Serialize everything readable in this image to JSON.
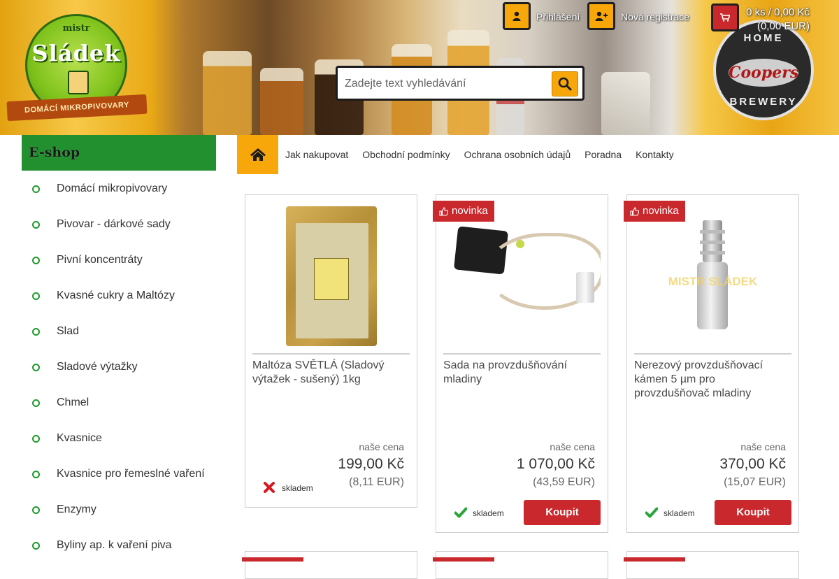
{
  "header": {
    "logo_left": {
      "top_text": "mistr",
      "main_text": "Sládek",
      "ribbon_text": "Domácí mikropivovary"
    },
    "logo_right": {
      "top_text": "HOME",
      "brand_text": "Coopers",
      "bottom_text": "BREWERY"
    },
    "login_label": "Přihlášení",
    "register_label": "Nová registrace",
    "cart_count_line": "0 ks / 0,00 Kč",
    "cart_eur_line": "(0,00 EUR)",
    "search_placeholder": "Zadejte text vyhledávání"
  },
  "sidebar": {
    "title": "E-shop",
    "items": [
      "Domácí mikropivovary",
      "Pivovar - dárkové sady",
      "Pivní koncentráty",
      "Kvasné cukry a Maltózy",
      "Slad",
      "Sladové výtažky",
      "Chmel",
      "Kvasnice",
      "Kvasnice pro řemeslné vaření",
      "Enzymy",
      "Byliny ap. k vaření piva"
    ]
  },
  "nav": {
    "items": [
      "Jak nakupovat",
      "Obchodní podmínky",
      "Ochrana osobních údajů",
      "Poradna",
      "Kontakty"
    ]
  },
  "products": [
    {
      "name": "Maltóza SVĚTLÁ (Sladový výtažek - sušený) 1kg",
      "price_label": "naše cena",
      "price": "199,00 Kč",
      "price_eur": "(8,11 EUR)",
      "stock": "skladem",
      "in_stock": false,
      "badge": "",
      "buy_label": ""
    },
    {
      "name": "Sada na provzdušňování mladiny",
      "price_label": "naše cena",
      "price": "1 070,00 Kč",
      "price_eur": "(43,59 EUR)",
      "stock": "skladem",
      "in_stock": true,
      "badge": "novinka",
      "buy_label": "Koupit"
    },
    {
      "name": "Nerezový provzdušňovací kámen 5 µm pro provzdušňovač mladiny",
      "price_label": "naše cena",
      "price": "370,00 Kč",
      "price_eur": "(15,07 EUR)",
      "stock": "skladem",
      "in_stock": true,
      "badge": "novinka",
      "buy_label": "Koupit",
      "image_watermark": "MISTR SLÁDEK"
    }
  ],
  "colors": {
    "accent_orange": "#f7a70a",
    "accent_red": "#c9282d",
    "sidebar_green": "#22902f"
  }
}
